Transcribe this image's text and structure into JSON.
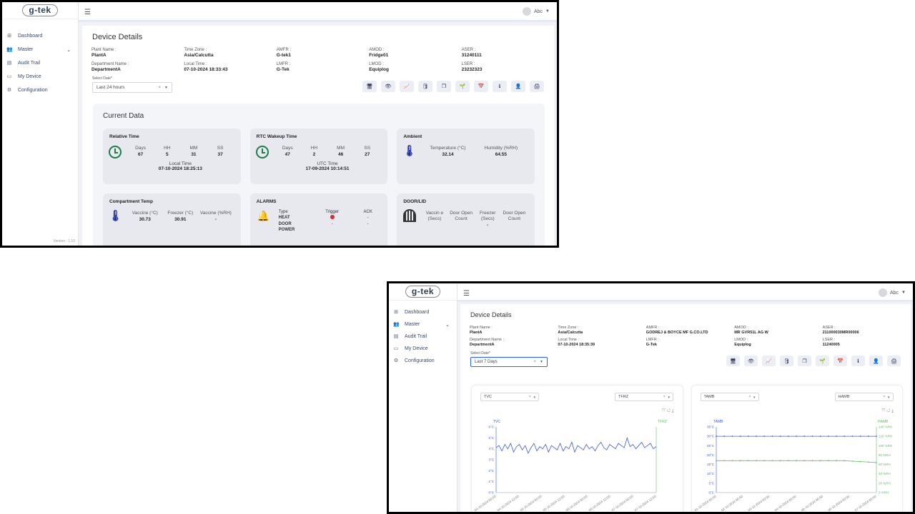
{
  "app": {
    "logo": "g-tek",
    "user": "Abc",
    "version": "Version : 1.10",
    "nav": [
      {
        "label": "Dashboard",
        "icon": "grid-icon"
      },
      {
        "label": "Master",
        "icon": "users-icon"
      },
      {
        "label": "Audit Trail",
        "icon": "archive-icon"
      },
      {
        "label": "My Device",
        "icon": "monitor-icon"
      },
      {
        "label": "Configuration",
        "icon": "gear-icon"
      }
    ]
  },
  "screen1": {
    "title": "Device Details",
    "fields": [
      {
        "label": "Plant Name :",
        "value": "PlantA"
      },
      {
        "label": "Time Zone :",
        "value": "Asia/Calcutta"
      },
      {
        "label": "AMFR :",
        "value": "G-tek1"
      },
      {
        "label": "AMOD :",
        "value": "Fridge01"
      },
      {
        "label": "ASER :",
        "value": "31240111"
      },
      {
        "label": "Department Name :",
        "value": "DepartmentA"
      },
      {
        "label": "Local Time :",
        "value": "07-10-2024 18:33:43"
      },
      {
        "label": "LMFR :",
        "value": "G-Tek"
      },
      {
        "label": "LMOD :",
        "value": "Equiplog"
      },
      {
        "label": "LSER :",
        "value": "23232323"
      }
    ],
    "select_label": "Select Date*",
    "select_value": "Last 24 hours",
    "current_title": "Current Data",
    "relative": {
      "title": "Relative Time",
      "heads": [
        "Days",
        "HH",
        "MM",
        "SS"
      ],
      "values": [
        "67",
        "5",
        "31",
        "37"
      ],
      "sub_label": "Local Time",
      "sub_value": "07-10-2024 18:25:13"
    },
    "rtc": {
      "title": "RTC Wakeup Time",
      "heads": [
        "Days",
        "HH",
        "MM",
        "SS"
      ],
      "values": [
        "47",
        "2",
        "46",
        "27"
      ],
      "sub_label": "UTC Time",
      "sub_value": "17-09-2024 10:14:51"
    },
    "ambient": {
      "title": "Ambient",
      "heads": [
        "Temperature (°C)",
        "Humidity (%RH)"
      ],
      "values": [
        "32.14",
        "64.55"
      ]
    },
    "compartment": {
      "title": "Compartment Temp",
      "heads": [
        "Vaccine (°C)",
        "Freezer (°C)",
        "Vaccine (%RH)"
      ],
      "values": [
        "30.73",
        "30.91",
        "-"
      ]
    },
    "alarms": {
      "title": "ALARMS",
      "heads": [
        "Type",
        "Trigger",
        "ACK"
      ],
      "rows": [
        {
          "type": "HEAT",
          "ack": "-"
        },
        {
          "type": "DOOR",
          "trigger": "-",
          "ack": "-"
        },
        {
          "type": "POWER"
        }
      ]
    },
    "door": {
      "title": "DOOR/LID",
      "heads": [
        "Vaccin e (Secs)",
        "Door Open Count",
        "Freezer (Secs)",
        "Door Open Count"
      ],
      "values": [
        "",
        "",
        "-",
        ""
      ]
    }
  },
  "screen2": {
    "title": "Device Details",
    "fields": [
      {
        "label": "Plant Name :",
        "value": "PlantA"
      },
      {
        "label": "Time Zone :",
        "value": "Asia/Calcutta"
      },
      {
        "label": "AMFR :",
        "value": "GODREJ & BOYCE MF G.CO.LTD"
      },
      {
        "label": "AMOD :",
        "value": "MR GVR51L AG W"
      },
      {
        "label": "ASER :",
        "value": "211000030MR00006"
      },
      {
        "label": "Department Name :",
        "value": "DepartmentA"
      },
      {
        "label": "Local Time :",
        "value": "07-10-2024 18:35:39"
      },
      {
        "label": "LMFR :",
        "value": "G-Tek"
      },
      {
        "label": "LMOD :",
        "value": "Equiplog"
      },
      {
        "label": "LSER :",
        "value": "11240005"
      }
    ],
    "select_label": "Select Date*",
    "select_value": "Last 7 Days",
    "left_chart": {
      "select_left": "TVC",
      "select_right": "TFRZ",
      "left_axis": "TVC",
      "right_axis": "TFRZ"
    },
    "right_chart": {
      "select_left": "TAMB",
      "select_right": "HAMB",
      "left_axis": "TAMB",
      "right_axis": "HAMB"
    }
  },
  "chart_data": [
    {
      "type": "line",
      "left_axis_ticks": [
        "6°C",
        "5°C",
        "4°C",
        "3°C",
        "2°C",
        "1°C",
        "0°C"
      ],
      "ylim": [
        0,
        6
      ],
      "x_ticks": [
        "04-10-2024 00:00",
        "04-10-2024 12:00",
        "05-10-2024 00:00",
        "05-10-2024 12:00",
        "06-10-2024 00:00",
        "06-10-2024 12:00",
        "07-10-2024 00:00",
        "07-10-2024 12:00"
      ],
      "series": [
        {
          "name": "TVC",
          "color": "#3b5bdb",
          "values": [
            4.1,
            4.3,
            3.8,
            4.4,
            4.0,
            4.5,
            3.7,
            4.2,
            4.4,
            3.9,
            4.3,
            3.6,
            4.1,
            4.5,
            3.8,
            4.2,
            4.0,
            4.4,
            3.7,
            4.3,
            4.1,
            3.9,
            4.5,
            3.8,
            4.2,
            4.0,
            4.6,
            3.7,
            4.3,
            4.1,
            3.9,
            4.4,
            4.0,
            4.2,
            3.8,
            4.3,
            4.6,
            4.1,
            3.9,
            4.4,
            4.2,
            4.0,
            4.5,
            4.3,
            4.1,
            5.0,
            4.2,
            4.4,
            4.0,
            4.3,
            4.6,
            4.1,
            4.3,
            4.5,
            4.0,
            4.2
          ]
        }
      ]
    },
    {
      "type": "line",
      "left_axis_ticks": [
        "35°C",
        "30°C",
        "25°C",
        "20°C",
        "15°C",
        "10°C",
        "5°C",
        "0°C"
      ],
      "right_axis_ticks": [
        "140 %RH",
        "120 %RH",
        "100 %RH",
        "80 %RH",
        "60 %RH",
        "40 %RH",
        "20 %RH",
        "0 %RH"
      ],
      "x_ticks": [
        "01-10-2024 00:00",
        "02-10-2024 00:00",
        "03-10-2024 00:00",
        "04-10-2024 00:00",
        "05-10-2024 00:00",
        "06-10-2024 00:00",
        "07-10-2024 00:00"
      ],
      "series": [
        {
          "name": "TAMB",
          "color": "#3b5bdb",
          "values": [
            30,
            30,
            30,
            30,
            30,
            30,
            30,
            30,
            30,
            30,
            30,
            30,
            30,
            30,
            30,
            30,
            30,
            30,
            30,
            30,
            30
          ]
        },
        {
          "name": "HAMB",
          "color": "#66bb6a",
          "values": [
            68,
            68,
            68,
            68,
            68,
            68,
            68,
            68,
            68,
            68,
            68,
            68,
            68,
            68,
            68,
            68,
            68,
            67,
            66,
            65,
            64
          ]
        }
      ]
    }
  ]
}
